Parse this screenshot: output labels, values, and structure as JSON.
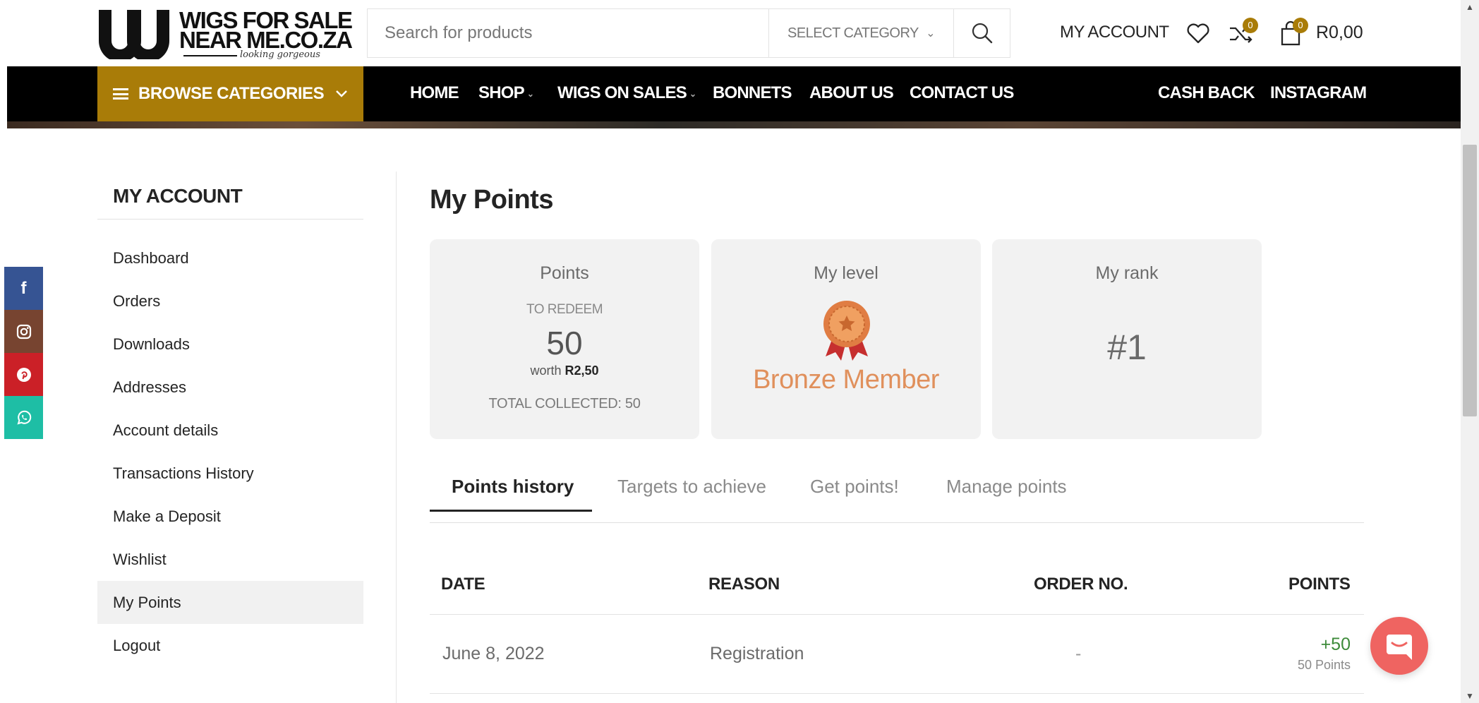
{
  "header": {
    "logo": {
      "line1": "WIGS FOR SALE",
      "line2": "NEAR ME.CO.ZA",
      "tagline": "looking gorgeous"
    },
    "search": {
      "placeholder": "Search for products",
      "category": "SELECT CATEGORY"
    },
    "account_link": "MY ACCOUNT",
    "compare_count": "0",
    "cart_count": "0",
    "cart_total": "R0,00",
    "icons": [
      "search-icon",
      "heart-icon",
      "shuffle-icon",
      "cart-icon",
      "chevron-down-icon"
    ]
  },
  "nav": {
    "browse_label": "BROWSE CATEGORIES",
    "items": [
      "HOME",
      "SHOP",
      "WIGS ON SALES",
      "BONNETS",
      "ABOUT US",
      "CONTACT US"
    ],
    "right_items": [
      "CASH BACK",
      "INSTAGRAM"
    ],
    "accent_color": "#a97c08"
  },
  "social": {
    "items": [
      {
        "name": "facebook-icon",
        "glyph": "f",
        "color": "#365493"
      },
      {
        "name": "instagram-icon",
        "glyph": "◎",
        "color": "#774430"
      },
      {
        "name": "pinterest-icon",
        "glyph": "℗",
        "color": "#cb2027"
      },
      {
        "name": "whatsapp-icon",
        "glyph": "✆",
        "color": "#1ebea5"
      }
    ]
  },
  "sidebar": {
    "title": "MY ACCOUNT",
    "items": [
      "Dashboard",
      "Orders",
      "Downloads",
      "Addresses",
      "Account details",
      "Transactions History",
      "Make a Deposit",
      "Wishlist",
      "My Points",
      "Logout"
    ],
    "active": "My Points"
  },
  "main": {
    "title": "My Points",
    "cards": {
      "points": {
        "head": "Points",
        "sub": "TO REDEEM",
        "value": "50",
        "worth_prefix": "worth",
        "worth_value": "R2,50",
        "total": "TOTAL COLLECTED:  50"
      },
      "level": {
        "head": "My level",
        "value": "Bronze Member",
        "color": "#e0905c"
      },
      "rank": {
        "head": "My rank",
        "value": "#1"
      }
    },
    "tabs": [
      "Points history",
      "Targets to achieve",
      "Get points!",
      "Manage points"
    ],
    "active_tab": "Points history",
    "table": {
      "headers": [
        "DATE",
        "REASON",
        "ORDER NO.",
        "POINTS"
      ],
      "rows": [
        {
          "date": "June 8, 2022",
          "reason": "Registration",
          "order": "-",
          "points": "+50",
          "points_sub": "50 Points"
        }
      ]
    }
  },
  "chat": {
    "icon": "chat-icon",
    "color": "#ef6461"
  }
}
